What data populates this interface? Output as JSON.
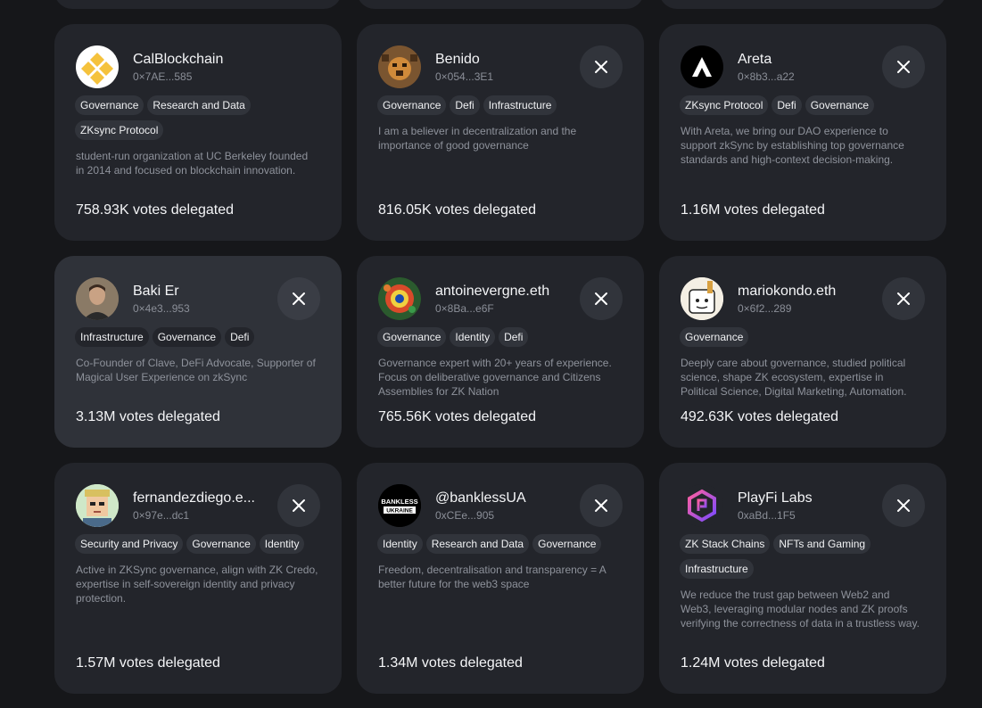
{
  "cards": [
    {
      "name": "CalBlockchain",
      "address": "0×7AE...585",
      "tags": [
        "Governance",
        "Research and Data",
        "ZKsync Protocol"
      ],
      "bio": "student-run organization at UC Berkeley founded in 2014 and focused on blockchain innovation.",
      "votes": "758.93K votes delegated",
      "has_x": false
    },
    {
      "name": "Benido",
      "address": "0×054...3E1",
      "tags": [
        "Governance",
        "Defi",
        "Infrastructure"
      ],
      "bio": "I am a believer in decentralization and the importance of good governance",
      "votes": "816.05K votes delegated",
      "has_x": true
    },
    {
      "name": "Areta",
      "address": "0×8b3...a22",
      "tags": [
        "ZKsync Protocol",
        "Defi",
        "Governance"
      ],
      "bio": "With Areta, we bring our DAO experience to support zkSync by establishing top governance standards and high-context decision-making.",
      "votes": "1.16M votes delegated",
      "has_x": true
    },
    {
      "name": "Baki Er",
      "address": "0×4e3...953",
      "tags": [
        "Infrastructure",
        "Governance",
        "Defi"
      ],
      "bio": "Co-Founder of Clave, DeFi Advocate, Supporter of Magical User Experience on zkSync",
      "votes": "3.13M votes delegated",
      "has_x": true
    },
    {
      "name": "antoinevergne.eth",
      "address": "0×8Ba...e6F",
      "tags": [
        "Governance",
        "Identity",
        "Defi"
      ],
      "bio": "Governance expert with 20+ years of experience. Focus on deliberative governance and Citizens Assemblies for ZK Nation",
      "votes": "765.56K votes delegated",
      "has_x": true
    },
    {
      "name": "mariokondo.eth",
      "address": "0×6f2...289",
      "tags": [
        "Governance"
      ],
      "bio": "Deeply care about governance, studied political science, shape ZK ecosystem, expertise in Political Science, Digital Marketing, Automation.",
      "votes": "492.63K votes delegated",
      "has_x": true
    },
    {
      "name": "fernandezdiego.e...",
      "address": "0×97e...dc1",
      "tags": [
        "Security and Privacy",
        "Governance",
        "Identity"
      ],
      "bio": "Active in ZKSync governance, align with ZK Credo, expertise in self-sovereign identity and privacy protection.",
      "votes": "1.57M votes delegated",
      "has_x": true
    },
    {
      "name": "@banklessUA",
      "address": "0xCEe...905",
      "tags": [
        "Identity",
        "Research and Data",
        "Governance"
      ],
      "bio": "Freedom, decentralisation and transparency = A better future for the web3 space",
      "votes": "1.34M votes delegated",
      "has_x": true
    },
    {
      "name": "PlayFi Labs",
      "address": "0xaBd...1F5",
      "tags": [
        "ZK Stack Chains",
        "NFTs and Gaming",
        "Infrastructure"
      ],
      "bio": "We reduce the trust gap between Web2 and Web3, leveraging modular nodes and ZK proofs verifying the correctness of data in a trustless way.",
      "votes": "1.24M votes delegated",
      "has_x": true
    }
  ],
  "bankless_logo_text": [
    "BANKLESS",
    "UKRAINE"
  ],
  "colors": {
    "background": "#16171a",
    "card": "#23252b",
    "card_hover": "#2f3239",
    "tag": "#31343b"
  }
}
